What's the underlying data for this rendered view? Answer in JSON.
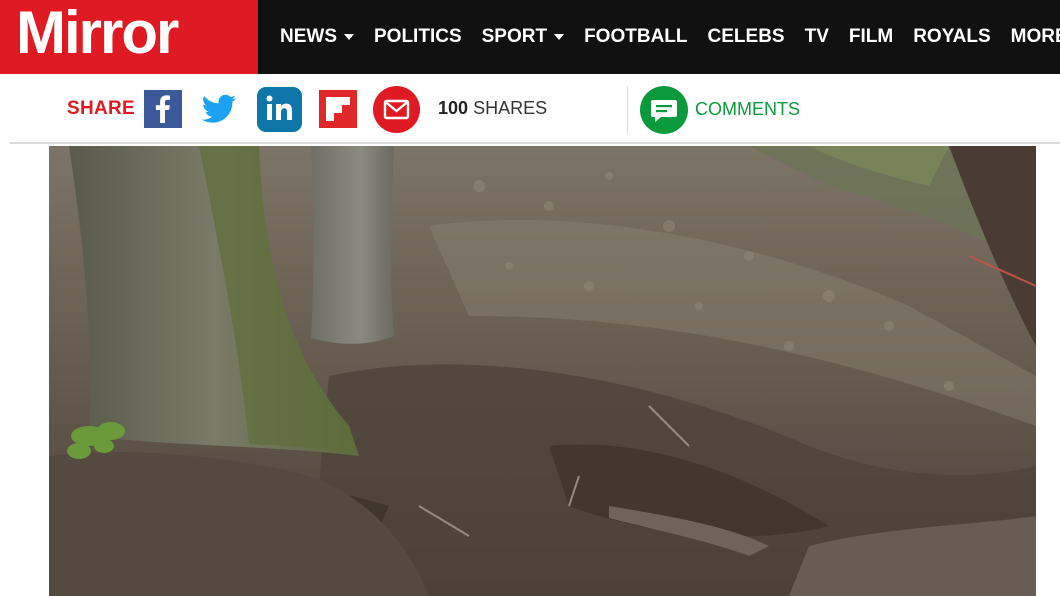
{
  "brand": {
    "name": "Mirror",
    "color": "#e01a22"
  },
  "nav": {
    "items": [
      {
        "label": "NEWS",
        "has_dropdown": true
      },
      {
        "label": "POLITICS",
        "has_dropdown": false
      },
      {
        "label": "SPORT",
        "has_dropdown": true
      },
      {
        "label": "FOOTBALL",
        "has_dropdown": false
      },
      {
        "label": "CELEBS",
        "has_dropdown": false
      },
      {
        "label": "TV",
        "has_dropdown": false
      },
      {
        "label": "FILM",
        "has_dropdown": false
      },
      {
        "label": "ROYALS",
        "has_dropdown": false
      },
      {
        "label": "MORE",
        "has_dropdown": false
      }
    ]
  },
  "share": {
    "label": "SHARE",
    "buttons": [
      {
        "icon": "facebook-icon",
        "color": "#3b5998"
      },
      {
        "icon": "twitter-icon",
        "color": "#1da1f2"
      },
      {
        "icon": "linkedin-icon",
        "color": "#0e76a8"
      },
      {
        "icon": "flipboard-icon",
        "color": "#e02828"
      },
      {
        "icon": "email-icon",
        "color": "#e01a22"
      }
    ],
    "count_number": "100",
    "count_label": "SHARES"
  },
  "comments": {
    "label": "COMMENTS",
    "icon": "comment-bubble-icon",
    "color": "#0a9a3c"
  },
  "article": {
    "image": {
      "icon": "article-photo"
    }
  }
}
